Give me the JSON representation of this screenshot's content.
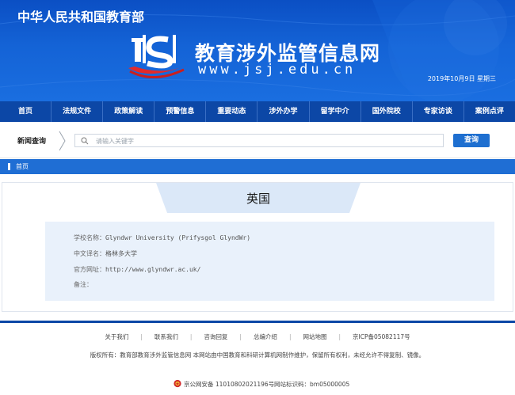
{
  "header": {
    "ministry": "中华人民共和国教育部",
    "site_name": "教育涉外监管信息网",
    "site_url": "www.jsj.edu.cn",
    "date": "2019年10月9日  星期三"
  },
  "nav": {
    "items": [
      {
        "label": "首页"
      },
      {
        "label": "法规文件"
      },
      {
        "label": "政策解读"
      },
      {
        "label": "预警信息"
      },
      {
        "label": "重要动态"
      },
      {
        "label": "涉外办学"
      },
      {
        "label": "留学中介"
      },
      {
        "label": "国外院校"
      },
      {
        "label": "专家访谈"
      },
      {
        "label": "案例点评"
      }
    ]
  },
  "search": {
    "label": "新闻查询",
    "placeholder": "请输入关键字",
    "button": "查询"
  },
  "breadcrumb": {
    "home": "首页"
  },
  "detail": {
    "country": "英国",
    "fields": [
      {
        "label": "学校名称：",
        "value": "Glyndwr University (Prifysgol GlyndWr)"
      },
      {
        "label": "中文译名：",
        "value": "格林多大学"
      },
      {
        "label": "官方网址：",
        "value": "http://www.glyndwr.ac.uk/"
      },
      {
        "label": "备注：",
        "value": ""
      }
    ]
  },
  "footer": {
    "links": [
      "关于我们",
      "联系我们",
      "咨询回复",
      "总编介绍",
      "网站地图",
      "京ICP备05082117号"
    ],
    "copyright": "版权所有：教育部教育涉外监管信息网 本网站由中国教育和科研计算机网制作维护，保留所有权利，未经允许不得复制、镜像。",
    "police": "京公网安备 11010802021196号",
    "site_id": "网站标识码：bm05000005"
  },
  "colors": {
    "banner_blue": "#1463d6",
    "nav_blue": "#0c47a6",
    "button_blue": "#1e6fd0",
    "panel_bg": "#e9f1fb"
  }
}
